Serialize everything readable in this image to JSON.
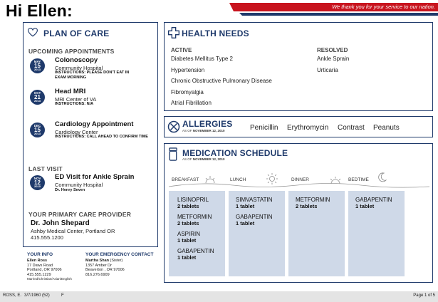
{
  "greeting": "Hi Ellen:",
  "header_tagline": "We thank you for your service to our nation.",
  "colors": {
    "navy": "#1f3a6b",
    "red": "#c8141e",
    "medbg": "#cfd9e8"
  },
  "plan": {
    "title": "PLAN OF CARE",
    "icon": "heart-icon",
    "upcoming_label": "UPCOMING APPOINTMENTS",
    "appointments": [
      {
        "month": "MAY",
        "day": "15",
        "year": "2013",
        "title": "Colonoscopy",
        "place": "Community Hospital",
        "instructions": "INSTRUCTIONS: PLEASE DON'T EAT IN EXAM MORNING"
      },
      {
        "month": "OCT",
        "day": "21",
        "year": "2013",
        "title": "Head MRI",
        "place": "MRI Center of VA",
        "instructions": "INSTRUCTIONS: N/A"
      },
      {
        "month": "DEC",
        "day": "15",
        "year": "2013",
        "title": "Cardiology Appointment",
        "place": "Cardiology Center",
        "instructions": "INSTRUCTIONS: CALL AHEAD TO CONFIRM TIME"
      }
    ],
    "last_visit_label": "LAST VISIT",
    "last_visit": {
      "month": "NOV",
      "day": "12",
      "year": "2010",
      "title": "ED Visit for Ankle Sprain",
      "place": "Community Hospital",
      "doctor": "Dr. Henry Seven"
    },
    "pcp_label": "YOUR PRIMARY CARE PROVIDER",
    "pcp_name": "Dr. John Shepard",
    "pcp_place": "Ashby Medical Center, Portland OR",
    "pcp_phone": "415.555.1200"
  },
  "your_info": {
    "label": "YOUR INFO",
    "name": "Ellen Ross",
    "address1": "17 Daws Road",
    "address2": "Portland, OR 97006",
    "phone": "415.555.1229",
    "extra": "Married/Christian/Asian/English"
  },
  "emergency": {
    "label": "YOUR EMERGENCY CONTACT",
    "name": "Martha Shan",
    "relation": "(Sister)",
    "address1": "1357 Amber Dr",
    "address2": "Beaverton , OR 97006",
    "phone": "816.276.6909"
  },
  "health": {
    "title": "HEALTH NEEDS",
    "icon": "medical-cross-icon",
    "active_label": "ACTIVE",
    "active": [
      "Diabetes Mellitus Type 2",
      "Hypertension",
      "Chronic Obstructive Pulmonary Disease",
      "Fibromyalgia",
      "Atrial Fibrillation"
    ],
    "resolved_label": "RESOLVED",
    "resolved": [
      "Ankle Sprain",
      "Urticaria"
    ]
  },
  "allergies": {
    "title": "ALLERGIES",
    "asof_prefix": "AS OF",
    "asof_date": "NOVEMBER 12, 2010",
    "icon": "no-allergy-icon",
    "items": [
      "Penicillin",
      "Erythromycin",
      "Contrast",
      "Peanuts"
    ]
  },
  "meds": {
    "title": "MEDICATION SCHEDULE",
    "asof_prefix": "AS OF",
    "asof_date": "NOVEMBER 12, 2010",
    "icon": "pill-bottle-icon",
    "times": [
      "BREAKFAST",
      "LUNCH",
      "DINNER",
      "BEDTIME"
    ],
    "breakfast": [
      {
        "name": "LISINOPRIL",
        "dose": "2 tablets"
      },
      {
        "name": "METFORMIN",
        "dose": "2 tablets"
      },
      {
        "name": "ASPIRIN",
        "dose": "1 tablet"
      },
      {
        "name": "GABAPENTIN",
        "dose": "1 tablet"
      }
    ],
    "lunch": [
      {
        "name": "SIMVASTATIN",
        "dose": "1 tablet"
      },
      {
        "name": "GABAPENTIN",
        "dose": "1 tablet"
      }
    ],
    "dinner": [
      {
        "name": "METFORMIN",
        "dose": "2 tablets"
      }
    ],
    "bedtime": [
      {
        "name": "GABAPENTIN",
        "dose": "1 tablet"
      }
    ]
  },
  "footer": {
    "patient": "ROSS, E.",
    "dob": "3/7/1960 (52)",
    "sex": "F",
    "page": "Page 1 of 5"
  }
}
